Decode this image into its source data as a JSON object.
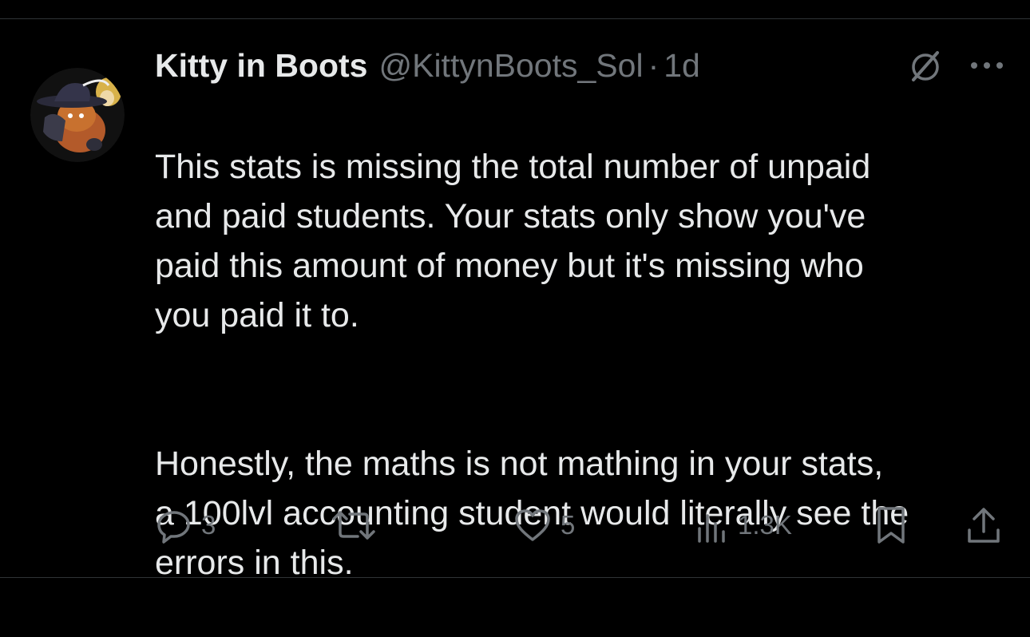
{
  "tweet": {
    "author": {
      "display_name": "Kitty in Boots",
      "handle": "@KittynBoots_Sol",
      "separator": "·",
      "time": "1d"
    },
    "text": {
      "paragraph_1": "This stats is missing the total number of unpaid\nand paid students. Your stats only show you've\npaid this amount of money but it's missing who\nyou paid it to.",
      "paragraph_2": "Honestly, the maths is not mathing in your stats,\na 100lvl accounting student would literally see the\nerrors in this."
    },
    "actions": {
      "reply_count": "3",
      "retweet_count": "",
      "like_count": "5",
      "view_count": "1.3K"
    },
    "icons": {
      "grok": "grok-icon",
      "more": "more-icon",
      "reply": "reply-icon",
      "retweet": "retweet-icon",
      "like": "heart-icon",
      "views": "views-icon",
      "bookmark": "bookmark-icon",
      "share": "share-icon"
    }
  },
  "colors": {
    "background": "#000000",
    "primary_text": "#e7e9ea",
    "secondary_text": "#71767b",
    "divider": "#2f3336"
  }
}
